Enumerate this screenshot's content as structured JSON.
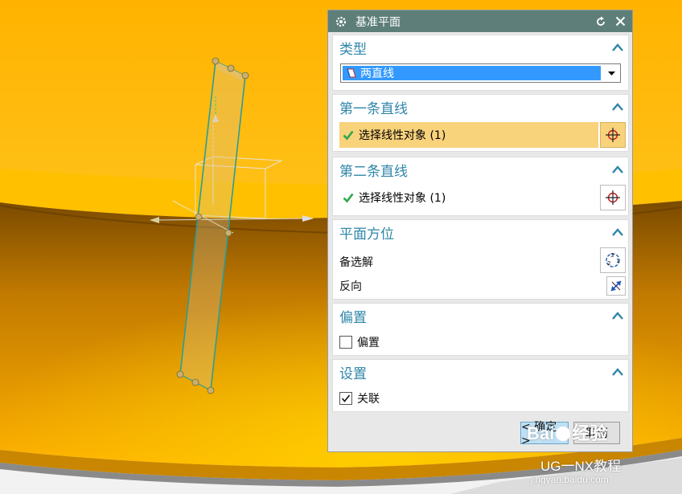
{
  "dialog": {
    "title": "基准平面",
    "sections": {
      "type": {
        "title": "类型",
        "selected": "两直线"
      },
      "first_line": {
        "title": "第一条直线",
        "select_label": "选择线性对象 (1)"
      },
      "second_line": {
        "title": "第二条直线",
        "select_label": "选择线性对象 (1)"
      },
      "orientation": {
        "title": "平面方位",
        "alternate_label": "备选解",
        "reverse_label": "反向"
      },
      "offset": {
        "title": "偏置",
        "checkbox_label": "偏置",
        "checked": false
      },
      "settings": {
        "title": "设置",
        "checkbox_label": "关联",
        "checked": true
      }
    },
    "buttons": {
      "ok_label": "< 确定 >",
      "cancel_label": "取消"
    }
  },
  "watermark": {
    "brand": "Bai",
    "brand2": "经验",
    "channel": "UG一NX教程",
    "site": "jingyan.baidu.com"
  },
  "colors": {
    "accent": "#2f86a8",
    "titlebar": "#5e7f79",
    "active_row": "#f9d27c",
    "model": "#f7b400"
  },
  "icons": [
    "gear-icon",
    "reset-icon",
    "close-icon",
    "chevron-up-icon",
    "plane-type-icon",
    "dropdown-arrow-icon",
    "checkmark-icon",
    "crosshair-icon",
    "cycle-solutions-icon",
    "reverse-direction-icon"
  ]
}
